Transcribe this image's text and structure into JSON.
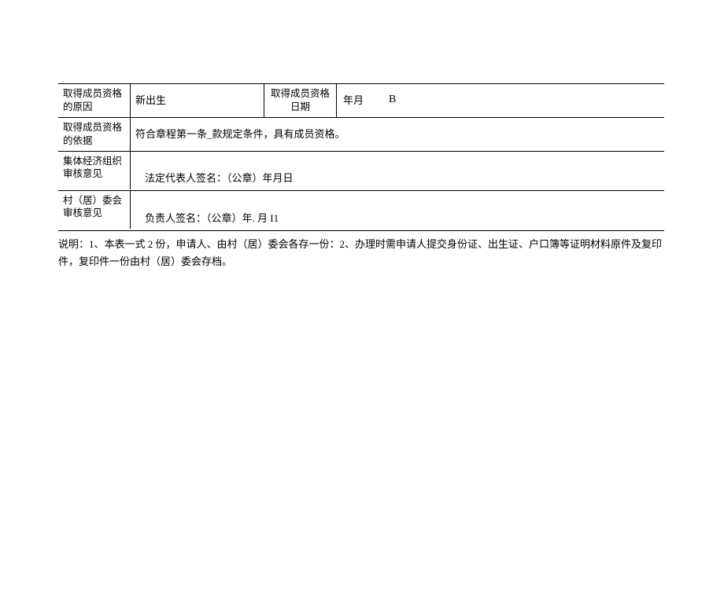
{
  "table": {
    "row1": {
      "label1": "取得成员资格的原因",
      "value1": "新出生",
      "label2": "取得成员资格日期",
      "value2_date": "年月",
      "value2_mark": "B"
    },
    "row2": {
      "label": "取得成员资格的依据",
      "value": "符合章程第一条_款规定条件，具有成员资格。"
    },
    "row3": {
      "label": "集体经济组织审核意见",
      "value": "法定代表人签名：（公章）年月日"
    },
    "row4": {
      "label": "村（居）委会审核意见",
      "value": "负责人签名：（公章）年. 月 I1"
    }
  },
  "note": "说明：1、本表一式 2 份，申请人、由村（居）委会各存一份：2、办理时需申请人提交身份证、出生证、户口簿等证明材料原件及复印件，复印件一份由村（居）委会存档。"
}
